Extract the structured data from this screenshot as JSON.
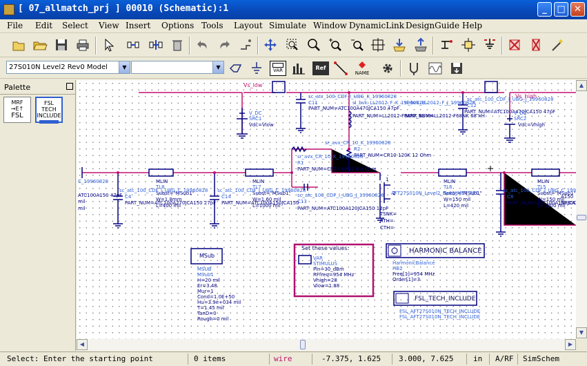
{
  "window": {
    "title": "[ 07_allmatch_prj ] 00010 (Schematic):1",
    "controls": {
      "minimize": "_",
      "maximize": "□",
      "close": "✕"
    }
  },
  "menu": [
    "File",
    "Edit",
    "Select",
    "View",
    "Insert",
    "Options",
    "Tools",
    "Layout",
    "Simulate",
    "Window",
    "DynamicLink",
    "DesignGuide",
    "Help"
  ],
  "toolbar": {
    "model_combo": "27S010N Level2 Rev0 Model",
    "component_combo": "",
    "var_label": "VAR",
    "name_label": "NAME",
    "ref_label": "Ref"
  },
  "palette": {
    "title": "Palette",
    "items": [
      {
        "label_lines": [
          "MRF",
          "→E↑",
          "FSL"
        ]
      },
      {
        "label_lines": [
          "FSL",
          "TECH",
          "INCLUDE"
        ]
      }
    ]
  },
  "schematic": {
    "net_vs_low": "Vs_low",
    "net_vs_high": "Vs_high",
    "src1": {
      "name": "V_DC",
      "id": "SRC1",
      "value": "Vdc=Vlow"
    },
    "src2": {
      "name": "V_DC",
      "id": "SRC2",
      "value": "Vdc=Vhigh"
    },
    "c11": {
      "part": "sc_atc_100_CDF_I_UBG_K_19960828",
      "id": "C11",
      "pn": "PART_NUM=ATC100A470JCA150 47pF"
    },
    "l_top": {
      "part": "sl_bvk_LL2012_F_K_19960828",
      "pn": "PART_NUM=LL2012-F68NK 68 nH"
    },
    "l_top2": {
      "part": "sl_bvk_LL2012_F_J_19960828",
      "pn": "PART_NUM=LL2012-F68NK 68 nH"
    },
    "c12": {
      "part": "sc_atc_100_CDF_I_UBG_J_19960828",
      "id": "C12",
      "pn": "PART_NUM=ATC100A470JCA150 47pF"
    },
    "r2": {
      "part": "sr_avx_CR_10_K_19960828",
      "id": "R2",
      "pn": "PART_NUM=CR10-120K 12 Ohm"
    },
    "r1": {
      "part": "sr_avx_CR_10_K_19960828",
      "id": "R1",
      "pn": "PART_NUM=CR10-6R81 6.8 Ohm"
    },
    "c13": {
      "part": "sc_atc_100_CDF_I_UBG_J_19960828",
      "id": "C13",
      "pn": "PART_NUM=ATC100A120JCA150 12pF"
    },
    "tl_left": {
      "name": "MLIN",
      "id": "TL8",
      "subst": "Subst=\"MSub1\"",
      "w": "W=1.8mm",
      "l": "L=400 mil"
    },
    "tl_mid": {
      "name": "MLIN",
      "id": "TL7",
      "subst": "Subst=\"MSub1\"",
      "w": "W=1.60 mil",
      "l": "L=1000 mil"
    },
    "tl6": {
      "name": "MLIN",
      "id": "TL6",
      "subst": "Subst=\"MSub1\"",
      "w": "W=150 mil",
      "l": "L=420 mil"
    },
    "tl5": {
      "name": "MLIN",
      "id": "TL5",
      "subst": "Subst=\"MSub1\"",
      "w": "W=150 mil",
      "l": "L=1000 mil"
    },
    "c4": {
      "part": "sc_atc_100_CDF_I_UBG_C_19960828",
      "id": "C4",
      "pn": "PART_NUM=ATC100A270JCA150 27pF"
    },
    "c14": {
      "part": "sc_atc_100_CDF_I_UBG_C_19960828",
      "id": "C14",
      "pn": "PART_NUM=ATC100A150JCA150"
    },
    "c8": {
      "part": "sc_atc_100_CDF_I_UBG_C_19960828",
      "id": "C8",
      "pn": "PART_NUM=ATC100A150JCA150"
    },
    "fet": {
      "part": "AFT27S010N_Level2_Rev0_MET_FET",
      "pins": [
        "TSNK=",
        "RTH=",
        "CTH="
      ],
      "pin_nums": [
        "1",
        "2"
      ]
    },
    "left_edge_labels": [
      "C_19960828",
      "ATC100A150 47pF",
      "mil",
      "mil"
    ],
    "right_edge_labels": [
      "A150",
      "NF30C"
    ],
    "msub_block": {
      "label": "MSub",
      "lines": [
        "MSUB",
        "MSub1",
        "H=20 mil",
        "Er=3.48",
        "Mur=1",
        "Cond=1.0E+50",
        "Hu=3.9e+034 mil",
        "T=1.45 mil",
        "TanD=0",
        "Rough=0 mil"
      ]
    },
    "var_block": {
      "title": "Set these values:",
      "lines": [
        "VAR",
        "STIMULUS",
        "Pin=30_dBm",
        "RFfreq=954 MHz",
        "Vhigh=28",
        "Vlow=1.88"
      ]
    },
    "hb_block": {
      "title": "HARMONIC BALANCE",
      "lines": [
        "HarmonicBalance",
        "HB2",
        "Freq[1]=954 MHz",
        "Order[1]=3"
      ]
    },
    "fsl_block": {
      "title": "FSL_TECH_INCLUDE",
      "lines": [
        "FSL_AFT27S010N_TECH_INCLUDE",
        "FSL_AFT27S010N_TECH_INCLUDE"
      ]
    }
  },
  "status": {
    "prompt": "Select: Enter the starting point",
    "items": "0 items",
    "mode": "wire",
    "coord1": "-7.375, 1.625",
    "coord2": "3.000, 7.625",
    "units": "in",
    "domain": "A/RF",
    "app": "SimSchem"
  },
  "colors": {
    "wire": "#c01070",
    "component": "#000080",
    "text": "#3060d8",
    "titlebar": "#0848b8"
  }
}
